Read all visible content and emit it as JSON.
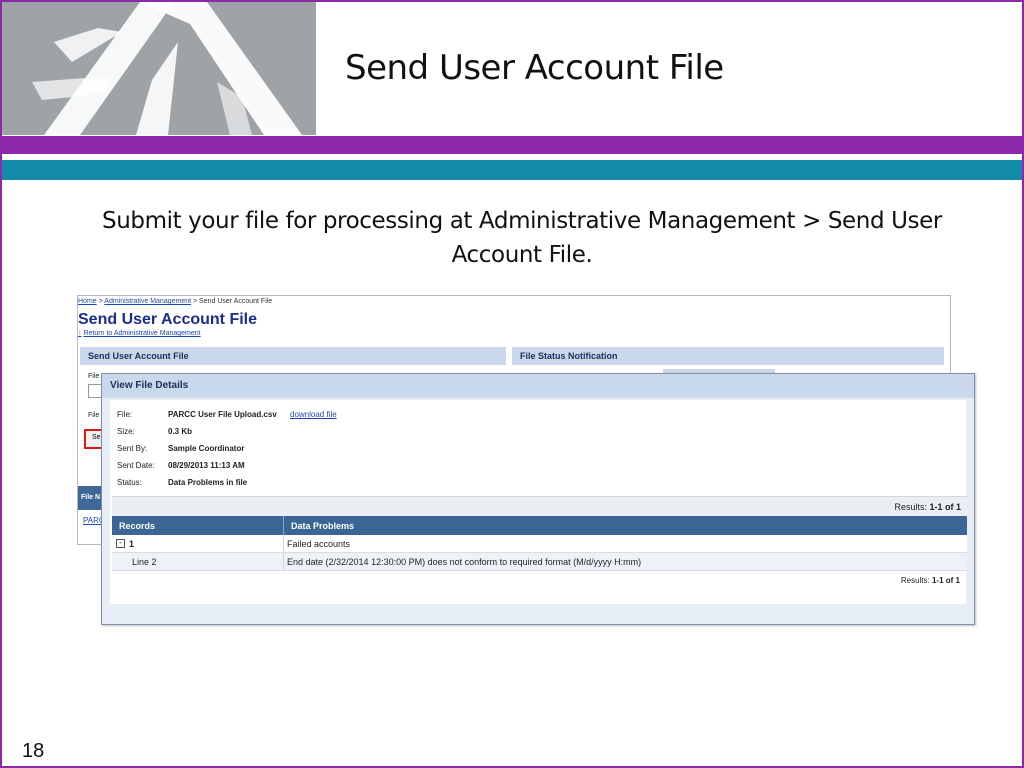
{
  "slide": {
    "title": "Send User Account File",
    "subtitle": "Submit your file for processing at Administrative Management > Send User Account File.",
    "number": "18"
  },
  "colors": {
    "purple": "#8e2aa9",
    "teal": "#138ba8",
    "logo_gray": "#9ea3a8",
    "header_blue": "#3a6594",
    "panel_blue": "#c9d8ea"
  },
  "background_screen": {
    "breadcrumb": {
      "home": "Home",
      "sep1": ">",
      "admin": "Administrative Management",
      "sep2": "> Send User Account File"
    },
    "page_title": "Send User Account File",
    "return_link": "Return to Administrative Management",
    "left_panel_title": "Send User Account File",
    "right_panel_title": "File Status Notification",
    "file_label_1": "File",
    "file_label_2": "File",
    "send_button_partial": "Se",
    "table_header_partial": "File N",
    "link_partial": "PARC"
  },
  "dialog": {
    "title": "View File Details",
    "details": {
      "file_label": "File:",
      "file_value": "PARCC User File Upload.csv",
      "download_link": "download file",
      "size_label": "Size:",
      "size_value": "0.3 Kb",
      "sent_by_label": "Sent By:",
      "sent_by_value": "Sample Coordinator",
      "sent_date_label": "Sent Date:",
      "sent_date_value": "08/29/2013 11:13 AM",
      "status_label": "Status:",
      "status_value": "Data Problems in file"
    },
    "results_label": "Results:",
    "results_value": "1-1 of 1",
    "columns": [
      "Records",
      "Data Problems"
    ],
    "rows": [
      {
        "toggle": "-",
        "record": "1",
        "problem": "Failed accounts"
      },
      {
        "record": "Line 2",
        "problem": "End date (2/32/2014 12:30:00 PM) does not conform to required format (M/d/yyyy H:mm)"
      }
    ]
  }
}
